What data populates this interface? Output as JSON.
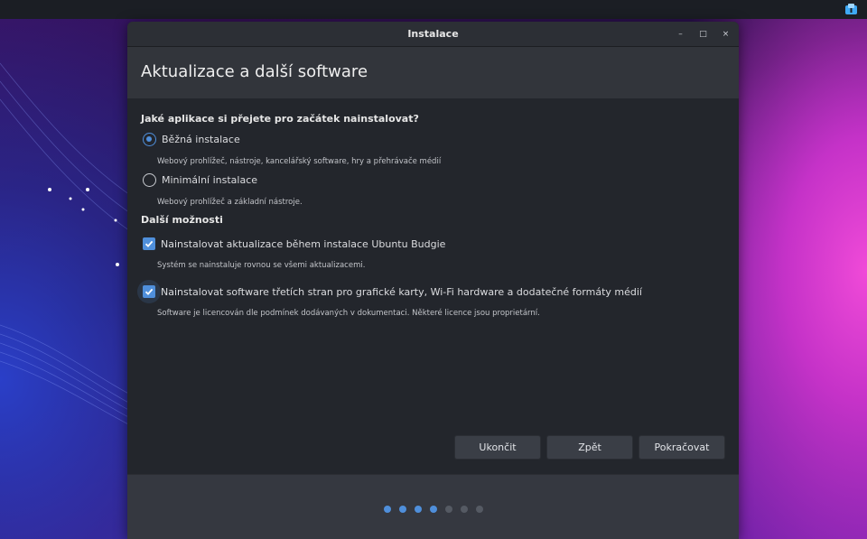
{
  "window": {
    "title": "Instalace",
    "minimize": "–",
    "maximize": "□",
    "close": "×"
  },
  "page": {
    "title": "Aktualizace a další software"
  },
  "install_type": {
    "question": "Jaké aplikace si přejete pro začátek nainstalovat?",
    "options": [
      {
        "label": "Běžná instalace",
        "description": "Webový prohlížeč, nástroje, kancelářský software, hry a přehrávače médií",
        "selected": true
      },
      {
        "label": "Minimální instalace",
        "description": "Webový prohlížeč a základní nástroje.",
        "selected": false
      }
    ]
  },
  "other_options": {
    "heading": "Další možnosti",
    "items": [
      {
        "label": "Nainstalovat aktualizace během instalace Ubuntu Budgie",
        "description": "Systém se nainstaluje rovnou se všemi aktualizacemi.",
        "checked": true
      },
      {
        "label": "Nainstalovat software třetích stran pro grafické karty, Wi-Fi hardware a dodatečné formáty médií",
        "description": "Software je licencován dle podmínek dodávaných v dokumentaci. Některé licence jsou proprietární.",
        "checked": true
      }
    ]
  },
  "buttons": {
    "quit": "Ukončit",
    "back": "Zpět",
    "continue": "Pokračovat"
  },
  "progress": {
    "total_steps": 7,
    "current_step": 4
  },
  "colors": {
    "accent": "#4f8fdb",
    "window_bg": "#23262c"
  },
  "icons": {
    "tray": "ubuntu-installer-icon"
  }
}
